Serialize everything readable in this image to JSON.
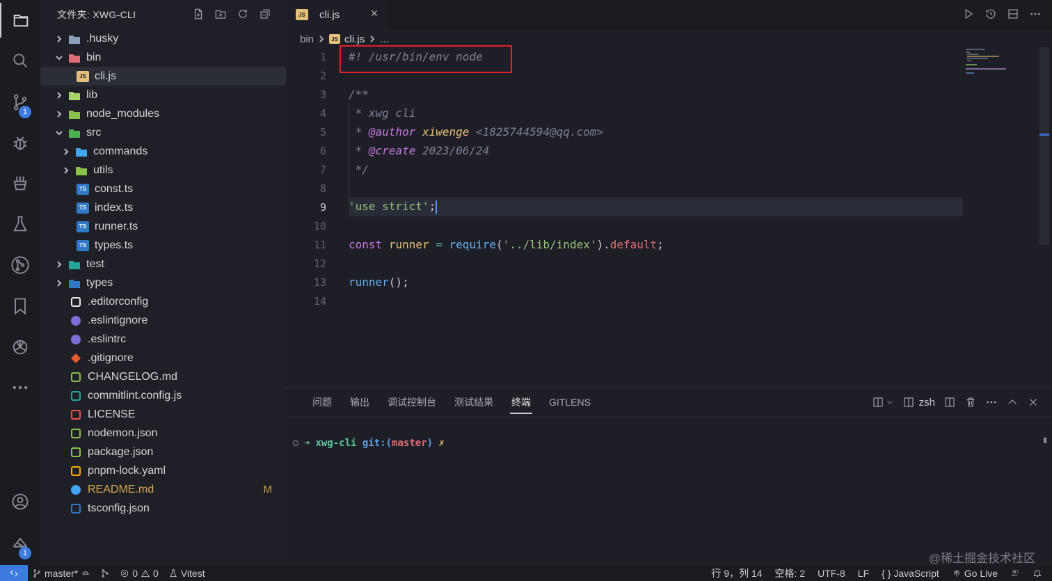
{
  "colors": {
    "accent": "#3d7be0",
    "highlight_box": "#e0202a",
    "modified": "#d9a84e"
  },
  "activity_bar": {
    "items": [
      {
        "name": "explorer-icon"
      },
      {
        "name": "search-icon"
      },
      {
        "name": "source-control-icon",
        "badge": "1"
      },
      {
        "name": "debug-icon"
      },
      {
        "name": "extensions-icon"
      },
      {
        "name": "testing-icon"
      },
      {
        "name": "gitlens-icon"
      },
      {
        "name": "bookmarks-icon"
      },
      {
        "name": "chatgpt-icon"
      },
      {
        "name": "more-icon"
      }
    ],
    "account_badge": "1"
  },
  "sidebar": {
    "title": "文件夹: XWG-CLI",
    "tree": [
      {
        "label": ".husky",
        "type": "folder",
        "expanded": false,
        "depth": 0,
        "icon": "husky-folder-icon",
        "color": "#8aa0b8"
      },
      {
        "label": "bin",
        "type": "folder",
        "expanded": true,
        "depth": 0,
        "icon": "bin-folder-icon",
        "color": "#e06c75"
      },
      {
        "label": "cli.js",
        "type": "file",
        "depth": 1,
        "icon": "js-file-icon",
        "color": "#e5c07b",
        "selected": true
      },
      {
        "label": "lib",
        "type": "folder",
        "expanded": false,
        "depth": 0,
        "icon": "lib-folder-icon",
        "color": "#a6d36a"
      },
      {
        "label": "node_modules",
        "type": "folder",
        "expanded": false,
        "depth": 0,
        "icon": "node-modules-folder-icon",
        "color": "#8bc34a"
      },
      {
        "label": "src",
        "type": "folder",
        "expanded": true,
        "depth": 0,
        "icon": "src-folder-icon",
        "color": "#4caf50"
      },
      {
        "label": "commands",
        "type": "folder",
        "expanded": false,
        "depth": 1,
        "icon": "commands-folder-icon",
        "color": "#42a5f5"
      },
      {
        "label": "utils",
        "type": "folder",
        "expanded": false,
        "depth": 1,
        "icon": "utils-folder-icon",
        "color": "#8bc34a"
      },
      {
        "label": "const.ts",
        "type": "file",
        "depth": 1,
        "icon": "ts-file-icon",
        "color": "#3178c6"
      },
      {
        "label": "index.ts",
        "type": "file",
        "depth": 1,
        "icon": "ts-file-icon",
        "color": "#3178c6"
      },
      {
        "label": "runner.ts",
        "type": "file",
        "depth": 1,
        "icon": "ts-file-icon",
        "color": "#3178c6"
      },
      {
        "label": "types.ts",
        "type": "file",
        "depth": 1,
        "icon": "ts-file-icon",
        "color": "#3178c6"
      },
      {
        "label": "test",
        "type": "folder",
        "expanded": false,
        "depth": 0,
        "icon": "test-folder-icon",
        "color": "#26a69a"
      },
      {
        "label": "types",
        "type": "folder",
        "expanded": false,
        "depth": 0,
        "icon": "types-folder-icon",
        "color": "#3178c6"
      },
      {
        "label": ".editorconfig",
        "type": "file",
        "depth": 0,
        "icon": "editorconfig-icon",
        "color": "#e8eaf0"
      },
      {
        "label": ".eslintignore",
        "type": "file",
        "depth": 0,
        "icon": "eslint-icon",
        "color": "#7c6fd6"
      },
      {
        "label": ".eslintrc",
        "type": "file",
        "depth": 0,
        "icon": "eslint-icon",
        "color": "#7c6fd6"
      },
      {
        "label": ".gitignore",
        "type": "file",
        "depth": 0,
        "icon": "git-icon",
        "color": "#e45a33"
      },
      {
        "label": "CHANGELOG.md",
        "type": "file",
        "depth": 0,
        "icon": "changelog-icon",
        "color": "#8bc34a"
      },
      {
        "label": "commitlint.config.js",
        "type": "file",
        "depth": 0,
        "icon": "commitlint-icon",
        "color": "#26a69a"
      },
      {
        "label": "LICENSE",
        "type": "file",
        "depth": 0,
        "icon": "license-icon",
        "color": "#ef5350"
      },
      {
        "label": "nodemon.json",
        "type": "file",
        "depth": 0,
        "icon": "nodemon-icon",
        "color": "#8bc34a"
      },
      {
        "label": "package.json",
        "type": "file",
        "depth": 0,
        "icon": "npm-package-icon",
        "color": "#8bc34a"
      },
      {
        "label": "pnpm-lock.yaml",
        "type": "file",
        "depth": 0,
        "icon": "pnpm-icon",
        "color": "#f9ad00"
      },
      {
        "label": "README.md",
        "type": "file",
        "depth": 0,
        "icon": "info-icon",
        "color": "#42a5f5",
        "modified": "M"
      },
      {
        "label": "tsconfig.json",
        "type": "file",
        "depth": 0,
        "icon": "tsconfig-icon",
        "color": "#3178c6"
      }
    ]
  },
  "editor": {
    "tab_label": "cli.js",
    "breadcrumb": [
      "bin",
      "cli.js",
      "..."
    ],
    "current_line": 9,
    "lines": [
      [
        {
          "t": "#! /usr/bin/env node",
          "c": "c-cm"
        }
      ],
      [],
      [
        {
          "t": "/**",
          "c": "c-cm"
        }
      ],
      [
        {
          "t": " * xwg cli",
          "c": "c-cm"
        }
      ],
      [
        {
          "t": " * ",
          "c": "c-cm"
        },
        {
          "t": "@author",
          "c": "c-tag"
        },
        {
          "t": " xiwenge ",
          "c": "c-auth"
        },
        {
          "t": "<1825744594@qq.com>",
          "c": "c-cm"
        }
      ],
      [
        {
          "t": " * ",
          "c": "c-cm"
        },
        {
          "t": "@create",
          "c": "c-tag"
        },
        {
          "t": " 2023/06/24",
          "c": "c-cm"
        }
      ],
      [
        {
          "t": " */",
          "c": "c-cm"
        }
      ],
      [],
      [
        {
          "t": "'use strict'",
          "c": "c-str"
        },
        {
          "t": ";",
          "c": "c-pl"
        }
      ],
      [],
      [
        {
          "t": "const",
          "c": "c-kw"
        },
        {
          "t": " ",
          "c": "c-pl"
        },
        {
          "t": "runner",
          "c": "c-var"
        },
        {
          "t": " ",
          "c": "c-pl"
        },
        {
          "t": "=",
          "c": "c-op"
        },
        {
          "t": " ",
          "c": "c-pl"
        },
        {
          "t": "require",
          "c": "c-fn"
        },
        {
          "t": "(",
          "c": "c-pl"
        },
        {
          "t": "'../lib/index'",
          "c": "c-str"
        },
        {
          "t": ").",
          "c": "c-pl"
        },
        {
          "t": "default",
          "c": "c-prop"
        },
        {
          "t": ";",
          "c": "c-pl"
        }
      ],
      [],
      [
        {
          "t": "runner",
          "c": "c-fn"
        },
        {
          "t": "();",
          "c": "c-pl"
        }
      ],
      []
    ]
  },
  "panel": {
    "tabs": [
      {
        "label": "问题",
        "active": false
      },
      {
        "label": "输出",
        "active": false
      },
      {
        "label": "调试控制台",
        "active": false
      },
      {
        "label": "测试结果",
        "active": false
      },
      {
        "label": "终端",
        "active": true
      },
      {
        "label": "GITLENS",
        "active": false
      }
    ],
    "shell_label": "zsh",
    "terminal": {
      "arrow": "➜",
      "dir": "xwg-cli",
      "git": "git:(",
      "branch": "master",
      "git_close": ")",
      "dirty": "✗"
    }
  },
  "watermark": "@稀土掘金技术社区",
  "status_bar": {
    "branch": "master*",
    "problems_errors": "0",
    "problems_warnings": "0",
    "vitest": "Vitest",
    "position": "行 9，列 14",
    "spaces": "空格: 2",
    "encoding": "UTF-8",
    "eol": "LF",
    "language": "JavaScript",
    "go_live": "Go Live"
  }
}
